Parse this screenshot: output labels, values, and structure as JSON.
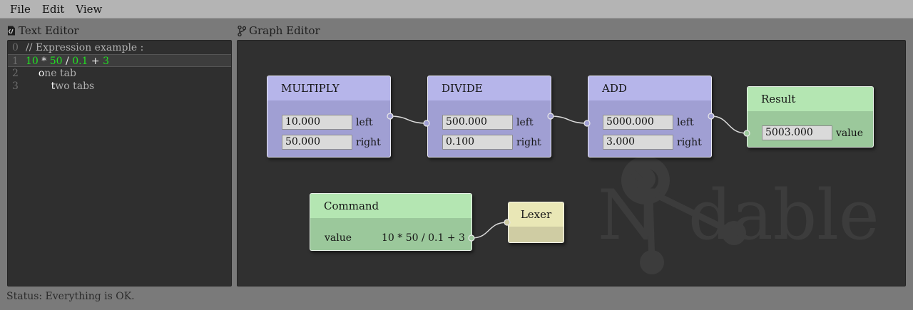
{
  "menu": {
    "file": "File",
    "edit": "Edit",
    "view": "View"
  },
  "text_editor": {
    "title": "Text Editor",
    "lines": [
      {
        "num": "0",
        "comment": "// Expression example :"
      },
      {
        "num": "1",
        "t1": "10",
        "t2": " * ",
        "t3": "50",
        "t4": " / ",
        "t5": "0.1",
        "t6": " + ",
        "t7": "3"
      },
      {
        "num": "2",
        "indent": "    ",
        "caret": "o",
        "rest": "ne tab"
      },
      {
        "num": "3",
        "indent": "        ",
        "caret": "t",
        "rest": "wo tabs"
      }
    ]
  },
  "graph_editor": {
    "title": "Graph Editor",
    "nodes": {
      "multiply": {
        "title": "MULTIPLY",
        "left_value": "10.000",
        "left_label": "left",
        "right_value": "50.000",
        "right_label": "right"
      },
      "divide": {
        "title": "DIVIDE",
        "left_value": "500.000",
        "left_label": "left",
        "right_value": "0.100",
        "right_label": "right"
      },
      "add": {
        "title": "ADD",
        "left_value": "5000.000",
        "left_label": "left",
        "right_value": "3.000",
        "right_label": "right"
      },
      "result": {
        "title": "Result",
        "value": "5003.000",
        "value_label": "value"
      },
      "command": {
        "title": "Command",
        "value_label": "value",
        "value": "10 * 50 / 0.1 + 3"
      },
      "lexer": {
        "title": "Lexer"
      }
    },
    "watermark_text": "Nodable"
  },
  "status": "Status: Everything is OK.",
  "colors": {
    "operator_node": "#a09fd3",
    "result_node": "#9bc89b",
    "lexer_node": "#cfcca3",
    "number_token": "#22e022",
    "canvas": "#303030"
  }
}
